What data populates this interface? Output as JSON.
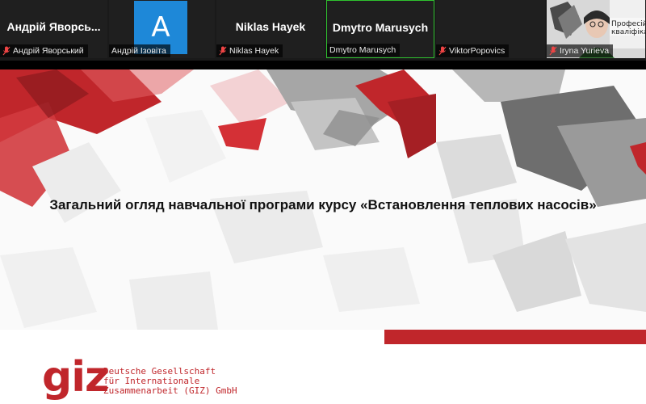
{
  "participants": [
    {
      "display_name": "Андрій Яворсь...",
      "label": "Андрій Яворський",
      "muted": true,
      "type": "name"
    },
    {
      "avatar_letter": "A",
      "label": "Андрій Ізовіта",
      "muted": false,
      "type": "avatar"
    },
    {
      "display_name": "Niklas Hayek",
      "label": "Niklas Hayek",
      "muted": true,
      "type": "name"
    },
    {
      "display_name": "Dmytro Marusych",
      "label": "Dmytro Marusych",
      "muted": false,
      "type": "name",
      "active_speaker": true
    },
    {
      "display_name": "",
      "label": "ViktorPopovics",
      "muted": true,
      "type": "name"
    },
    {
      "label": "Iryna Yurieva",
      "muted": true,
      "type": "video",
      "video_text": [
        "Професій",
        "кваліфікац"
      ]
    }
  ],
  "slide": {
    "title": "Загальний огляд навчальної програми курсу «Встановлення теплових насосів»",
    "logo": "giz",
    "org_lines": [
      "Deutsche Gesellschaft",
      "für Internationale",
      "Zusammenarbeit (GIZ) GmbH"
    ]
  },
  "colors": {
    "brand_red": "#c0262b",
    "active_border": "#2fc32f",
    "avatar_blue": "#1e88d8"
  }
}
